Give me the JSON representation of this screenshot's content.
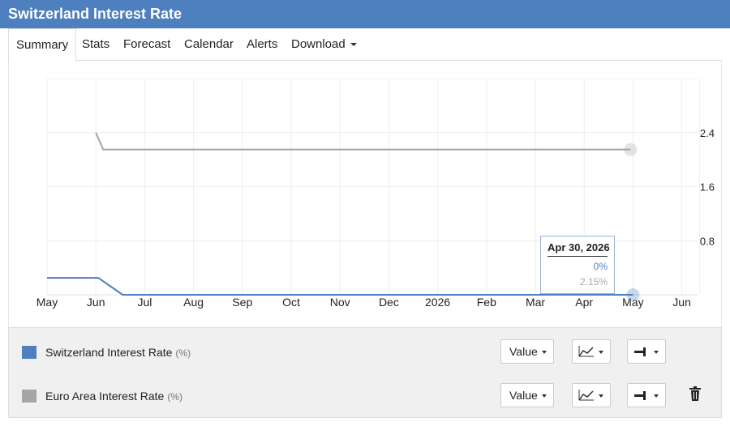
{
  "header": {
    "title": "Switzerland Interest Rate"
  },
  "tabs": [
    {
      "label": "Summary",
      "active": true
    },
    {
      "label": "Stats"
    },
    {
      "label": "Forecast"
    },
    {
      "label": "Calendar"
    },
    {
      "label": "Alerts"
    },
    {
      "label": "Download",
      "dropdown": true
    }
  ],
  "tooltip": {
    "date": "Apr 30, 2026",
    "value1": "0%",
    "value2": "2.15%"
  },
  "legend": [
    {
      "name": "Switzerland Interest Rate",
      "unit": "(%)",
      "color": "#4e7fbe",
      "value_label": "Value",
      "deletable": false
    },
    {
      "name": "Euro Area Interest Rate",
      "unit": "(%)",
      "color": "#a6a6a6",
      "value_label": "Value",
      "deletable": true
    }
  ],
  "icons": {
    "chart_type": "line-chart-icon",
    "axis": "axis-icon",
    "delete": "trash-icon",
    "dropdown": "caret-down-icon"
  },
  "chart_data": {
    "type": "line",
    "x_ticks": [
      "May",
      "Jun",
      "Jul",
      "Aug",
      "Sep",
      "Oct",
      "Nov",
      "Dec",
      "2026",
      "Feb",
      "Mar",
      "Apr",
      "May",
      "Jun"
    ],
    "y_ticks": [
      "0.8",
      "1.6",
      "2.4"
    ],
    "ylim": [
      0,
      3.2
    ],
    "grid": true,
    "series": [
      {
        "name": "Switzerland Interest Rate",
        "color": "#4e7fbe",
        "points": [
          [
            0,
            0.25
          ],
          [
            1.05,
            0.25
          ],
          [
            1.55,
            0
          ],
          [
            11.95,
            0
          ],
          [
            12.0,
            0
          ]
        ]
      },
      {
        "name": "Euro Area Interest Rate",
        "color": "#a6a6a6",
        "points": [
          [
            1.0,
            2.4
          ],
          [
            1.15,
            2.15
          ],
          [
            11.95,
            2.15
          ]
        ]
      }
    ],
    "highlight_index": 11.95
  }
}
